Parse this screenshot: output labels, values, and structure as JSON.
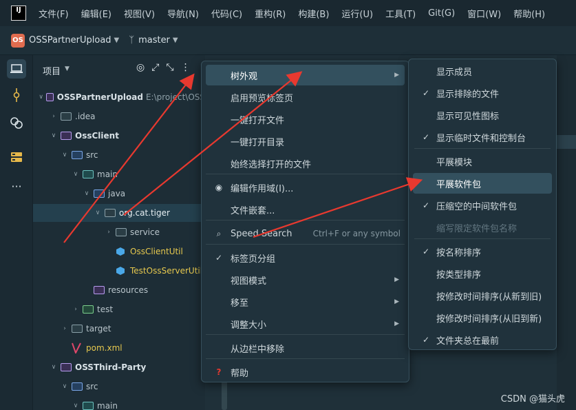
{
  "menubar": {
    "logo": "IJ",
    "items": [
      "文件(F)",
      "编辑(E)",
      "视图(V)",
      "导航(N)",
      "代码(C)",
      "重构(R)",
      "构建(B)",
      "运行(U)",
      "工具(T)",
      "Git(G)",
      "窗口(W)",
      "帮助(H)"
    ]
  },
  "toolbar": {
    "project_badge": "OS",
    "project_name": "OSSPartnerUpload",
    "branch": "master"
  },
  "panel": {
    "title": "项目",
    "tree": [
      {
        "label": "OSSPartnerUpload",
        "extra": "E:\\project\\OSS",
        "indent": 0,
        "icon": "folder-purple",
        "caret": "v",
        "style": "bold"
      },
      {
        "label": ".idea",
        "extra": "",
        "indent": 1,
        "icon": "folder-grey",
        "caret": ">",
        "style": ""
      },
      {
        "label": "OssClient",
        "extra": "",
        "indent": 1,
        "icon": "folder-purple",
        "caret": "v",
        "style": "bold"
      },
      {
        "label": "src",
        "extra": "",
        "indent": 2,
        "icon": "folder-blue",
        "caret": "v",
        "style": ""
      },
      {
        "label": "main",
        "extra": "",
        "indent": 3,
        "icon": "folder-teal",
        "caret": "v",
        "style": ""
      },
      {
        "label": "java",
        "extra": "",
        "indent": 4,
        "icon": "folder-blue",
        "caret": "v",
        "style": ""
      },
      {
        "label": "org.cat.tiger",
        "extra": "",
        "indent": 5,
        "icon": "folder-grey",
        "caret": "v",
        "style": "selected"
      },
      {
        "label": "service",
        "extra": "",
        "indent": 6,
        "icon": "folder-grey",
        "caret": ">",
        "style": ""
      },
      {
        "label": "OssClientUtil",
        "extra": "",
        "indent": 6,
        "icon": "class",
        "caret": "",
        "style": "yellow"
      },
      {
        "label": "TestOssServerUtil",
        "extra": "",
        "indent": 6,
        "icon": "class",
        "caret": "",
        "style": "yellow"
      },
      {
        "label": "resources",
        "extra": "",
        "indent": 4,
        "icon": "folder-purple",
        "caret": "",
        "style": ""
      },
      {
        "label": "test",
        "extra": "",
        "indent": 3,
        "icon": "folder-green",
        "caret": ">",
        "style": ""
      },
      {
        "label": "target",
        "extra": "",
        "indent": 2,
        "icon": "folder-grey",
        "caret": ">",
        "style": ""
      },
      {
        "label": "pom.xml",
        "extra": "",
        "indent": 2,
        "icon": "maven",
        "caret": "",
        "style": "yellow"
      },
      {
        "label": "OSSThird-Party",
        "extra": "",
        "indent": 1,
        "icon": "folder-purple",
        "caret": "v",
        "style": "bold"
      },
      {
        "label": "src",
        "extra": "",
        "indent": 2,
        "icon": "folder-blue",
        "caret": "v",
        "style": ""
      },
      {
        "label": "main",
        "extra": "",
        "indent": 3,
        "icon": "folder-teal",
        "caret": "v",
        "style": ""
      }
    ]
  },
  "context_menu": {
    "items": [
      {
        "label": "树外观",
        "icon": "",
        "arrow": true,
        "shortcut": "",
        "highlighted": true
      },
      {
        "label": "启用预览标签页",
        "icon": "",
        "arrow": false,
        "shortcut": ""
      },
      {
        "label": "一键打开文件",
        "icon": "",
        "arrow": false,
        "shortcut": ""
      },
      {
        "label": "一键打开目录",
        "icon": "",
        "arrow": false,
        "shortcut": ""
      },
      {
        "label": "始终选择打开的文件",
        "icon": "",
        "arrow": false,
        "shortcut": ""
      },
      {
        "label": "编辑作用域(I)...",
        "icon": "radio",
        "arrow": false,
        "shortcut": ""
      },
      {
        "label": "文件嵌套...",
        "icon": "",
        "arrow": false,
        "shortcut": ""
      },
      {
        "label": "Speed Search",
        "icon": "search",
        "arrow": false,
        "shortcut": "Ctrl+F or any symbol"
      },
      {
        "label": "标签页分组",
        "icon": "check",
        "arrow": false,
        "shortcut": ""
      },
      {
        "label": "视图模式",
        "icon": "",
        "arrow": true,
        "shortcut": ""
      },
      {
        "label": "移至",
        "icon": "",
        "arrow": true,
        "shortcut": ""
      },
      {
        "label": "调整大小",
        "icon": "",
        "arrow": true,
        "shortcut": ""
      },
      {
        "label": "从边栏中移除",
        "icon": "",
        "arrow": false,
        "shortcut": ""
      },
      {
        "label": "帮助",
        "icon": "help",
        "arrow": false,
        "shortcut": ""
      }
    ]
  },
  "submenu": {
    "items": [
      {
        "label": "显示成员",
        "checked": false,
        "disabled": false,
        "highlighted": false
      },
      {
        "label": "显示排除的文件",
        "checked": true,
        "disabled": false,
        "highlighted": false
      },
      {
        "label": "显示可见性图标",
        "checked": false,
        "disabled": false,
        "highlighted": false
      },
      {
        "label": "显示临时文件和控制台",
        "checked": true,
        "disabled": false,
        "highlighted": false
      },
      {
        "label": "平展模块",
        "checked": false,
        "disabled": false,
        "highlighted": false
      },
      {
        "label": "平展软件包",
        "checked": false,
        "disabled": false,
        "highlighted": true
      },
      {
        "label": "压缩空的中间软件包",
        "checked": true,
        "disabled": false,
        "highlighted": false
      },
      {
        "label": "缩写限定软件包名称",
        "checked": false,
        "disabled": true,
        "highlighted": false
      },
      {
        "label": "按名称排序",
        "checked": true,
        "disabled": false,
        "highlighted": false
      },
      {
        "label": "按类型排序",
        "checked": false,
        "disabled": false,
        "highlighted": false
      },
      {
        "label": "按修改时间排序(从新到旧)",
        "checked": false,
        "disabled": false,
        "highlighted": false
      },
      {
        "label": "按修改时间排序(从旧到新)",
        "checked": false,
        "disabled": false,
        "highlighted": false
      },
      {
        "label": "文件夹总在最前",
        "checked": true,
        "disabled": false,
        "highlighted": false
      }
    ]
  },
  "watermark": "CSDN @猫头虎",
  "colors": {
    "arrow": "#e8392f",
    "accent": "#33505e"
  }
}
